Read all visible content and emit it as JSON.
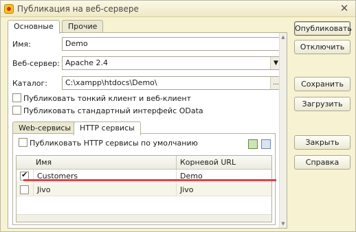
{
  "window": {
    "title": "Публикация на веб-сервере",
    "close_label": "✕"
  },
  "tabs": [
    {
      "label": "Основные",
      "active": true
    },
    {
      "label": "Прочие",
      "active": false
    }
  ],
  "form": {
    "name_label": "Имя:",
    "name_value": "Demo",
    "server_label": "Веб-сервер:",
    "server_value": "Apache 2.4",
    "catalog_label": "Каталог:",
    "catalog_value": "C:\\xampp\\htdocs\\Demo\\",
    "catalog_dots": "...",
    "publish_thin_client": "Публиковать тонкий клиент и веб-клиент",
    "publish_odata": "Публиковать стандартный интерфейс OData"
  },
  "inner_tabs": [
    {
      "label": "Web-сервисы",
      "active": false
    },
    {
      "label": "HTTP сервисы",
      "active": true
    }
  ],
  "http": {
    "publish_default_label": "Публиковать HTTP сервисы по умолчанию",
    "columns": {
      "name": "Имя",
      "root_url": "Корневой URL"
    },
    "rows": [
      {
        "checked": true,
        "name": "Customers",
        "root_url": "Demo"
      },
      {
        "checked": false,
        "name": "Jivo",
        "root_url": "Jivo"
      }
    ]
  },
  "buttons": {
    "publish": "Опубликовать",
    "disable": "Отключить",
    "save": "Сохранить",
    "load": "Загрузить",
    "close": "Закрыть",
    "help": "Справка"
  },
  "icons": {
    "app": "app-icon",
    "check_all": "check-all-icon",
    "copy": "copy-icon"
  },
  "colors": {
    "window_bg": "#f6f2d2",
    "highlight_line": "#e0404a"
  }
}
